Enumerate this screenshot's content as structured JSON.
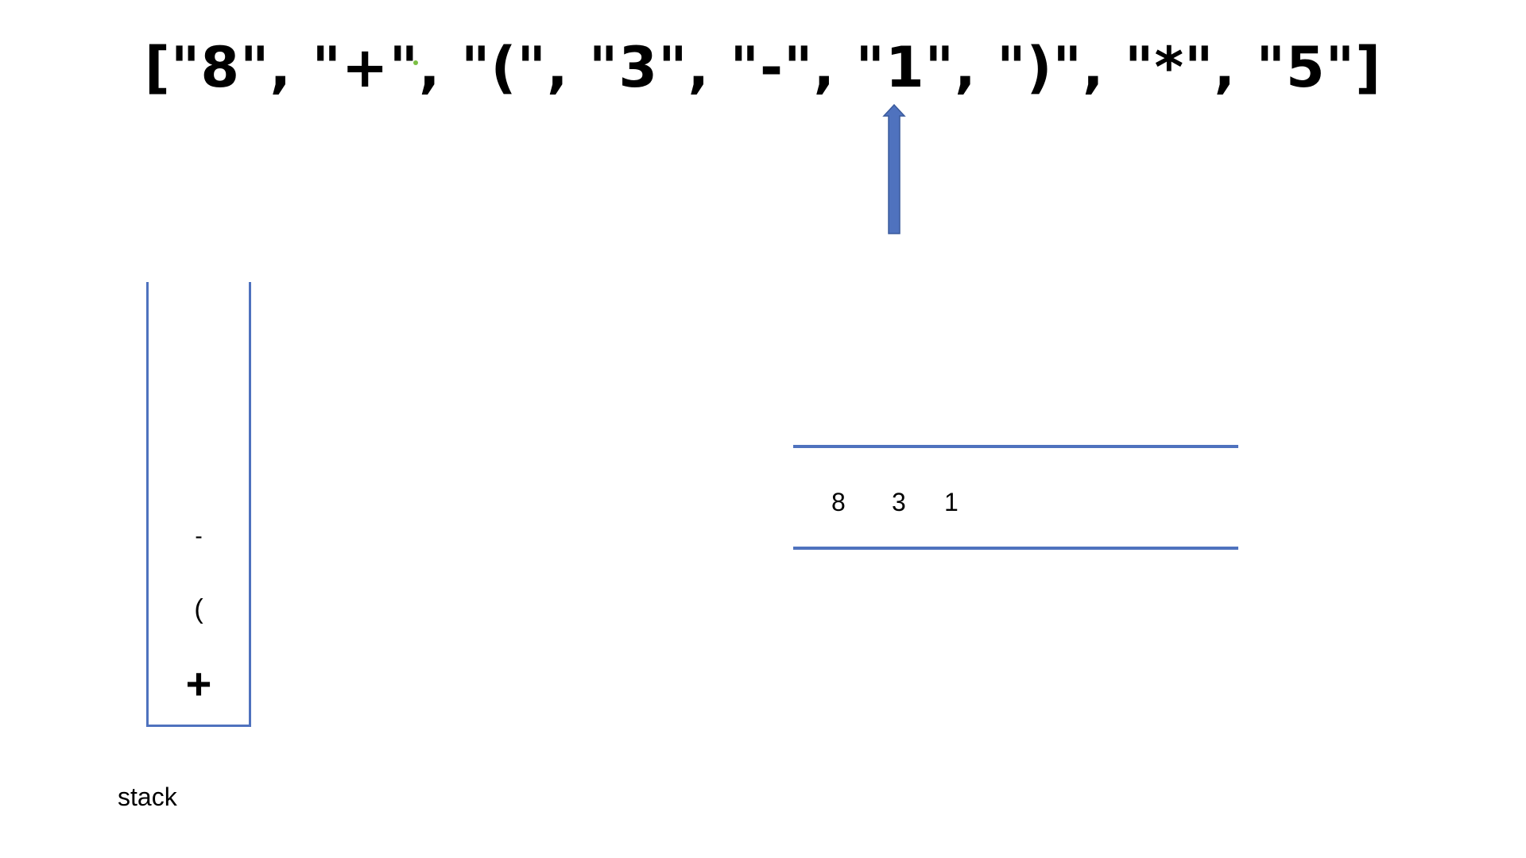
{
  "diagram": {
    "token_array": "[\"8\", \"+\", \"(\", \"3\", \"-\", \"1\", \")\", \"*\", \"5\"]",
    "current_token_index": 5,
    "stack": {
      "label": "stack",
      "items_bottom_to_top": [
        "+",
        "(",
        "-"
      ]
    },
    "output": {
      "items": [
        "8",
        "3",
        "1"
      ]
    },
    "colors": {
      "accent": "#4f72be",
      "text": "#000000",
      "background": "#ffffff"
    }
  }
}
